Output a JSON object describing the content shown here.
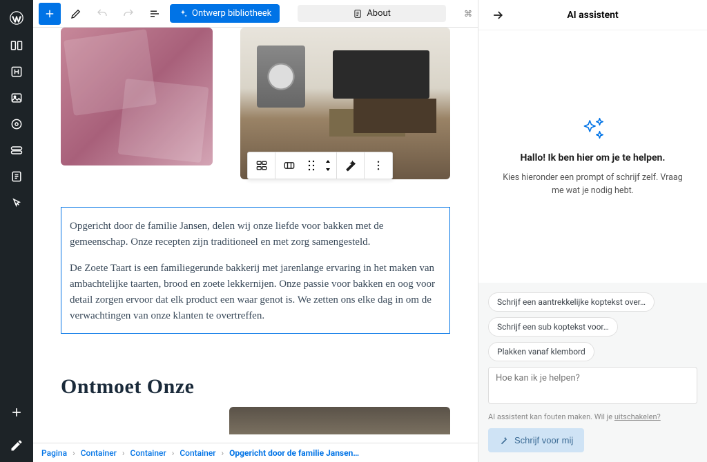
{
  "toolbar": {
    "design_library": "Ontwerp bibliotheek",
    "page_label": "About",
    "shortcut": "⌘"
  },
  "canvas": {
    "paragraph1": "Opgericht door de familie Jansen, delen wij onze liefde voor bakken met de gemeenschap. Onze recepten zijn traditioneel en met zorg samengesteld.",
    "paragraph2": "De Zoete Taart is een familiegerunde bakkerij met jarenlange ervaring in het maken van ambachtelijke taarten, brood en zoete lekkernijen. Onze passie voor bakken en oog voor detail zorgen ervoor dat elk product een waar genot is. We zetten ons elke dag in om de verwachtingen van onze klanten te overtreffen.",
    "section_heading": "Ontmoet Onze"
  },
  "breadcrumb": {
    "items": [
      "Pagina",
      "Container",
      "Container",
      "Container",
      "Opgericht door de familie Jansen…"
    ]
  },
  "ai": {
    "title": "AI assistent",
    "headline": "Hallo! Ik ben hier om je te helpen.",
    "subtext": "Kies hieronder een prompt of schrijf zelf. Vraag me wat je nodig hebt.",
    "chips": {
      "c1": "Schrijf een aantrekkelijke koptekst over…",
      "c2": "Schrijf een sub koptekst voor…",
      "c3": "Plakken vanaf klembord"
    },
    "placeholder": "Hoe kan ik je helpen?",
    "disclaimer_pre": "AI assistent kan fouten maken. Wil je ",
    "disclaimer_link": "uitschakelen?",
    "write_btn": "Schrijf voor mij"
  }
}
